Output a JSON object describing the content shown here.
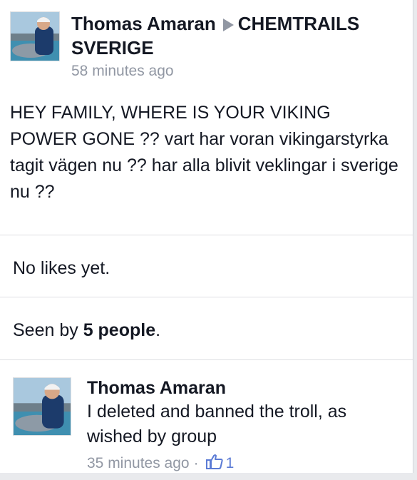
{
  "post": {
    "author": "Thomas Amaran",
    "group": "CHEMTRAILS SVERIGE",
    "time": "58 minutes ago",
    "body": "HEY FAMILY, WHERE IS YOUR VIKING POWER GONE ??   vart har voran vikingarstyrka tagit vägen nu ??  har alla blivit veklingar i sverige nu ??"
  },
  "likes": {
    "text": "No likes yet."
  },
  "seen": {
    "prefix": "Seen by ",
    "count": "5 people",
    "suffix": "."
  },
  "comment": {
    "author": "Thomas Amaran",
    "text": "I deleted and banned the troll, as wished by group",
    "time": "35 minutes ago",
    "separator": "·",
    "like_count": "1"
  },
  "icons": {
    "arrow": "right-arrow-icon",
    "like": "thumbs-up-icon"
  },
  "colors": {
    "text": "#141823",
    "muted": "#9197a3",
    "like_blue": "#5b7bd5"
  }
}
